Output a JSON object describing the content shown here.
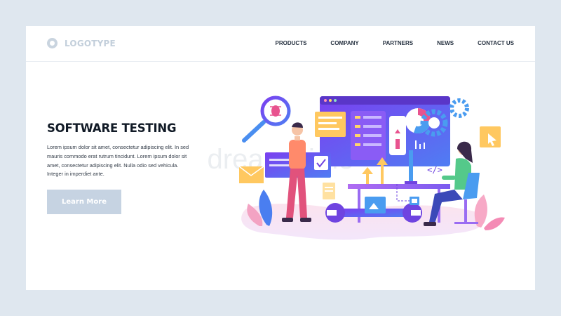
{
  "header": {
    "logo_text": "LOGOTYPE",
    "nav": [
      {
        "label": "PRODUCTS"
      },
      {
        "label": "COMPANY"
      },
      {
        "label": "PARTNERS"
      },
      {
        "label": "NEWS"
      },
      {
        "label": "CONTACT US"
      }
    ]
  },
  "hero": {
    "title": "SOFTWARE TESTING",
    "description": "Lorem ipsum dolor sit amet, consectetur adipiscing elit. In sed mauris commodo erat rutrum tincidunt. Lorem ipsum dolor sit amet, consectetur adipiscing elit. Nulla  odio sed vehicula. Integer in imperdiet ante.",
    "cta_label": "Learn More"
  },
  "illustration": {
    "code_symbol": "</>",
    "watermark": "dreamstime"
  },
  "colors": {
    "page_bg": "#dfe7ef",
    "card_bg": "#ffffff",
    "cta_bg": "#c6d3e2",
    "accent_purple": "#6f44e0",
    "accent_orange": "#f5a623",
    "accent_pink": "#e8538f",
    "accent_blue": "#4a9cf0"
  }
}
